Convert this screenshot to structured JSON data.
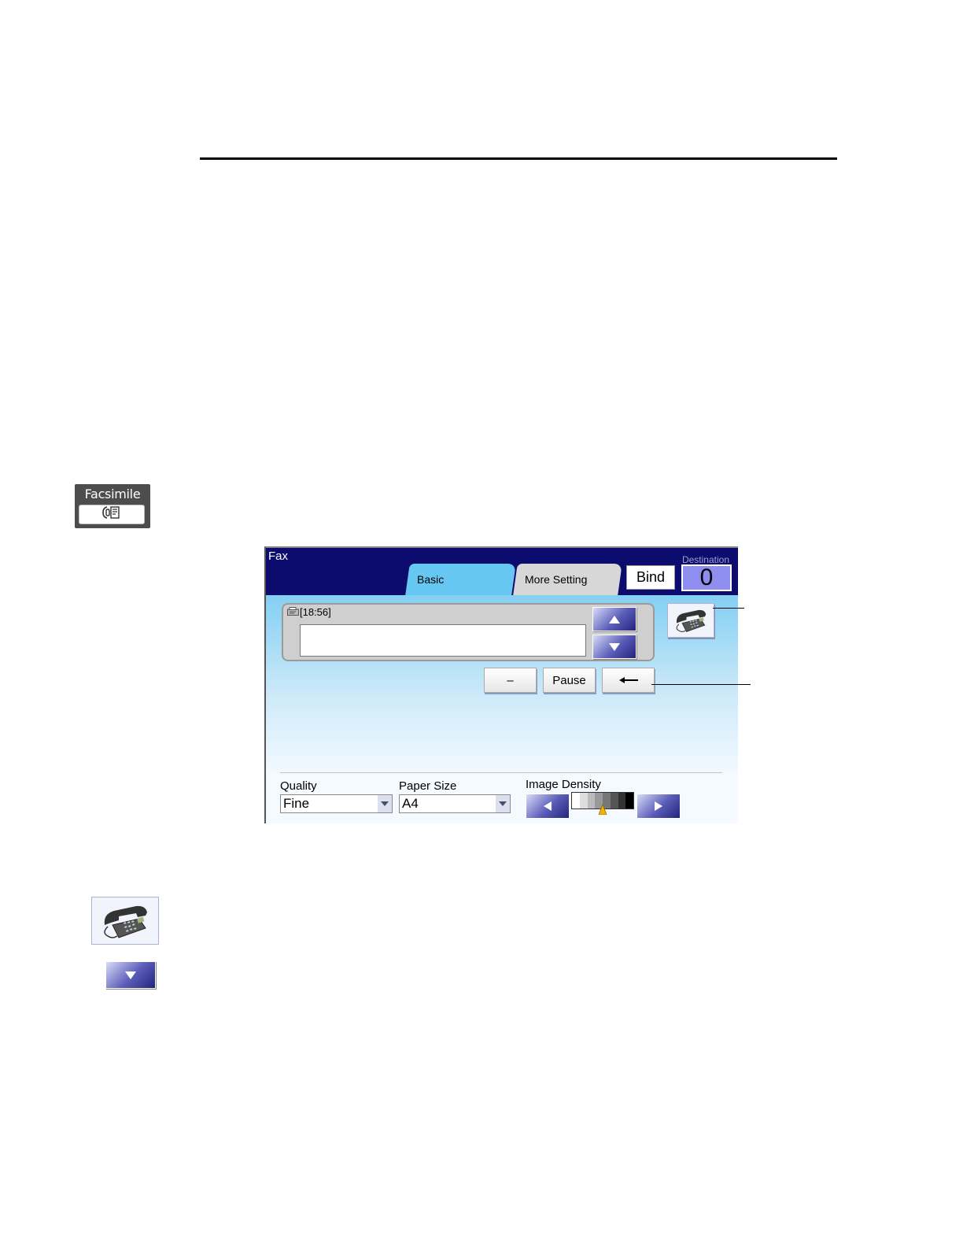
{
  "hardware_key": {
    "label": "Facsimile"
  },
  "screen": {
    "title": "Fax",
    "tabs": [
      {
        "label": "Basic"
      },
      {
        "label": "More Setting"
      }
    ],
    "bind_label": "Bind",
    "destination": {
      "label": "Destination",
      "count": "0"
    },
    "entry": {
      "timestamp": "[18:56]",
      "value": ""
    },
    "keys": {
      "dash": "–",
      "pause": "Pause"
    },
    "quality": {
      "label": "Quality",
      "value": "Fine"
    },
    "paper_size": {
      "label": "Paper Size",
      "value": "A4"
    },
    "image_density": {
      "label": "Image Density",
      "level_fraction": 0.5
    }
  },
  "icons": {
    "phone": "telephone-icon",
    "up": "arrow-up-icon",
    "down": "arrow-down-icon",
    "back": "backspace-arrow-icon",
    "left": "arrow-left-icon",
    "right": "arrow-right-icon",
    "fax_key": "fax-icon"
  },
  "colors": {
    "header": "#0c0c6e",
    "tab_active": "#66c8f2",
    "tab_inactive": "#d7d7d7",
    "destination_box": "#8e8ef0"
  }
}
